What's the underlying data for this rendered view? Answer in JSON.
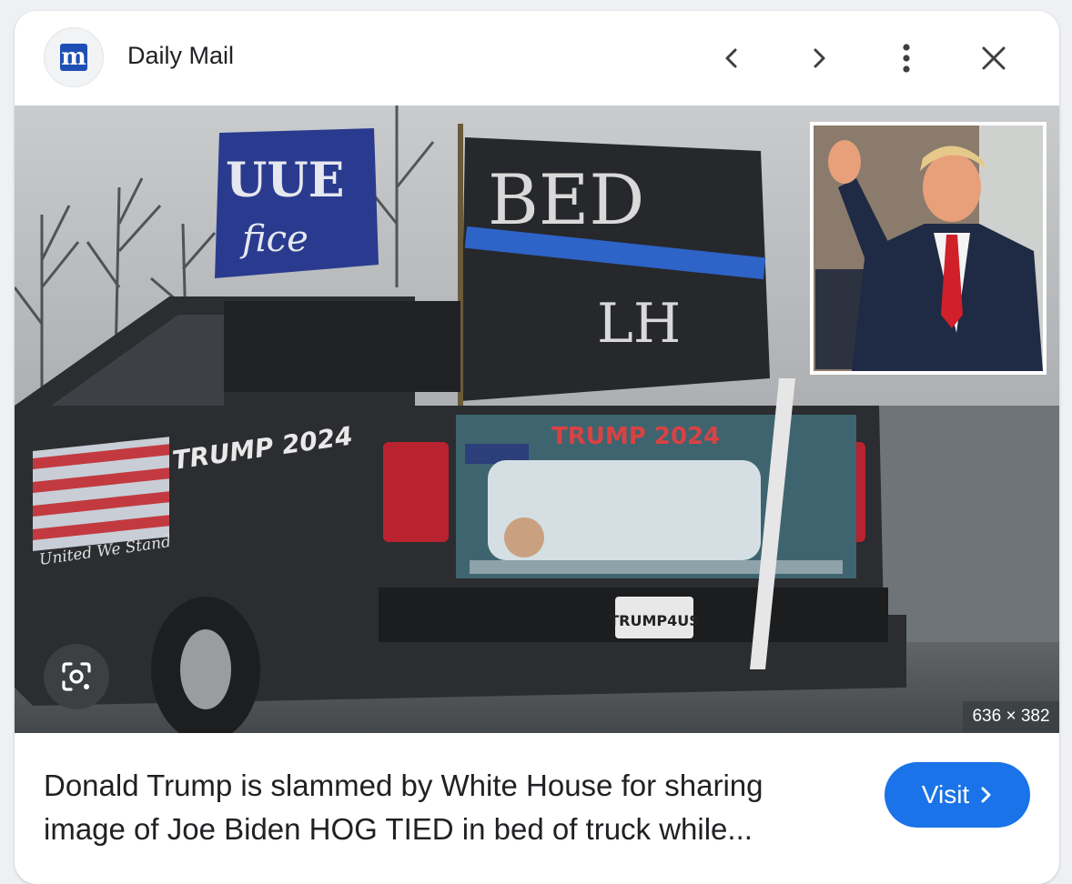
{
  "header": {
    "favicon_letter": "m",
    "source_name": "Daily Mail",
    "icons": [
      "chevron-left-icon",
      "chevron-right-icon",
      "more-vert-icon",
      "close-icon"
    ]
  },
  "image": {
    "signs": {
      "left_flag_line1": "UUE",
      "left_flag_line2": "fice",
      "right_flag_line1": "BED",
      "right_flag_line2": "LH",
      "truck_side": "TRUMP 2024",
      "truck_side_script": "United We Stand",
      "banner": "TRUMP 2024",
      "license_plate": "TRUMP4US"
    },
    "dimensions": "636 × 382"
  },
  "caption": {
    "title": "Donald Trump is slammed by White House for sharing image of Joe Biden HOG TIED in bed of truck while..."
  },
  "visit_button": {
    "label": "Visit"
  },
  "colors": {
    "accent": "#1a73e8",
    "favicon": "#1e4fb5",
    "tie": "#d0202a"
  }
}
